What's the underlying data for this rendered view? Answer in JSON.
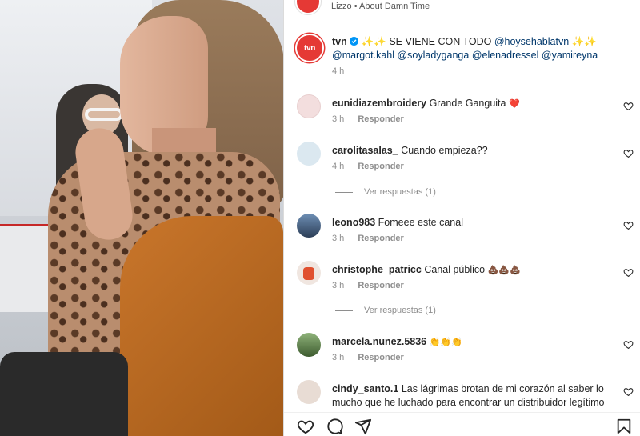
{
  "music": {
    "artist": "Lizzo",
    "separator": " • ",
    "song": "About Damn Time"
  },
  "post": {
    "username": "tvn",
    "avatar_text": "tvn",
    "caption_prefix": "✨✨ SE VIENE CON TODO ",
    "mention1": "@hoysehablatvn",
    "caption_mid": " ✨✨",
    "mention2": "@margot.kahl",
    "mention3": "@soyladyganga",
    "mention4": "@elenadressel",
    "mention5": "@yamireyna",
    "time": "4 h"
  },
  "comments": [
    {
      "user": "eunidiazembroidery",
      "text": "Grande Ganguita",
      "emoji": "❤️",
      "time": "3 h",
      "reply": "Responder"
    },
    {
      "user": "carolitasalas_",
      "text": "Cuando empieza??",
      "emoji": "",
      "time": "4 h",
      "reply": "Responder",
      "view_replies": "Ver respuestas (1)"
    },
    {
      "user": "leono983",
      "text": "Fomeee este canal",
      "emoji": "",
      "time": "3 h",
      "reply": "Responder"
    },
    {
      "user": "christophe_patricc",
      "text": "Canal público",
      "emoji": "💩💩💩",
      "time": "3 h",
      "reply": "Responder",
      "view_replies": "Ver respuestas (1)"
    },
    {
      "user": "marcela.nunez.5836",
      "text": "",
      "emoji": "👏👏👏",
      "time": "3 h",
      "reply": "Responder"
    },
    {
      "user": "cindy_santo.1",
      "text": "Las lágrimas brotan de mi corazón al saber lo mucho que he luchado para encontrar un distribuidor legítimo",
      "emoji": "",
      "time": "",
      "reply": ""
    }
  ],
  "icons": [
    "heart-icon",
    "comment-icon",
    "share-icon",
    "bookmark-icon",
    "verified-icon"
  ],
  "colors": {
    "brand_red": "#e53935",
    "mention": "#00376b",
    "meta_gray": "#8e8e8e",
    "heart_red": "#ed1c24"
  }
}
